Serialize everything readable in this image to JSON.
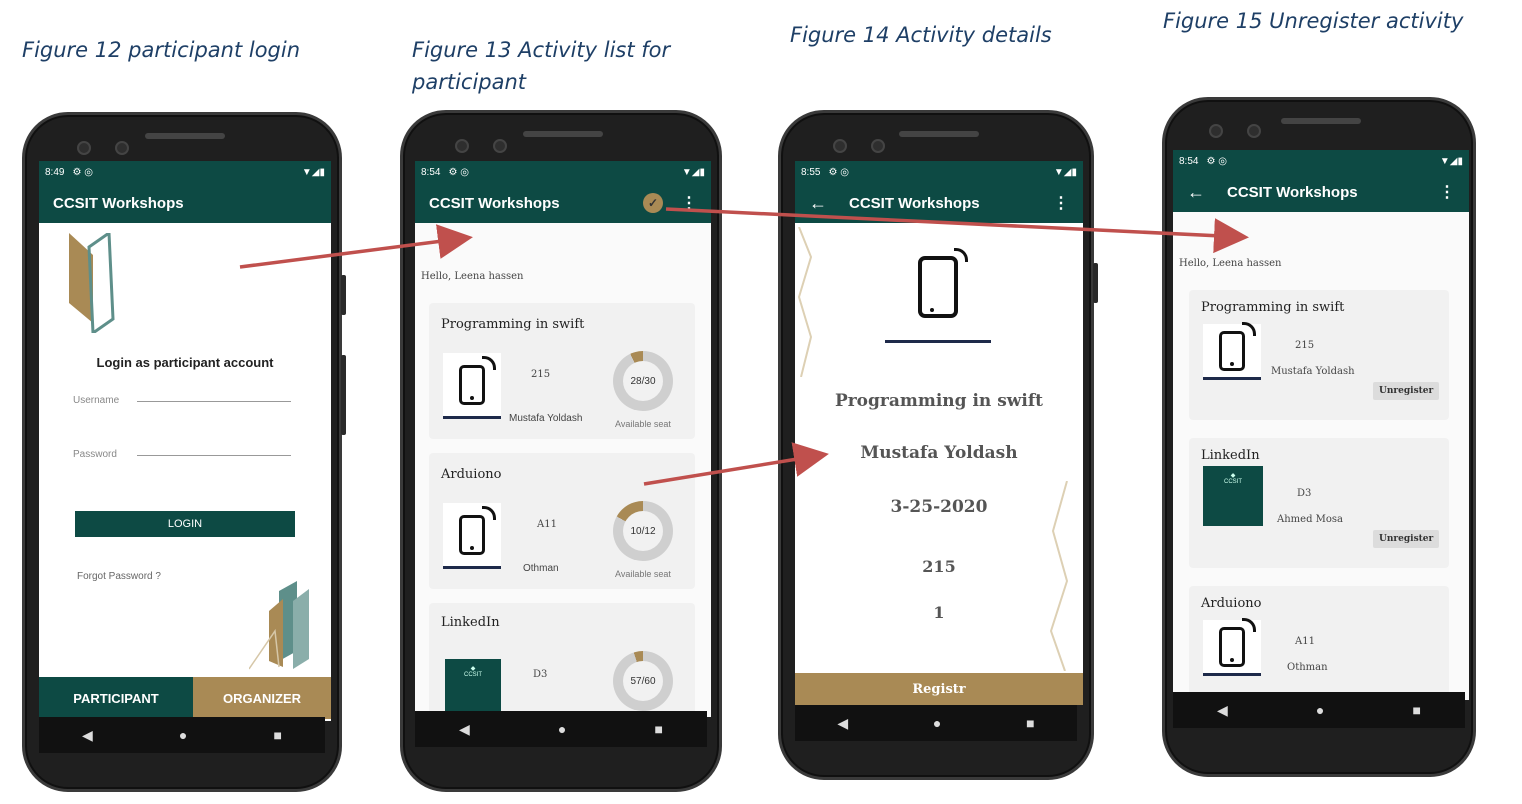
{
  "captions": {
    "fig12": "Figure 12  participant login",
    "fig13a": "Figure 13 Activity list for",
    "fig13b": "participant",
    "fig14": "Figure 14 Activity details",
    "fig15": "Figure 15 Unregister activity"
  },
  "colors": {
    "primary": "#0d4a44",
    "accent": "#a98a55",
    "arrow": "#c0504d"
  },
  "phone1": {
    "time": "8:49",
    "app_title": "CCSIT Workshops",
    "heading": "Login as participant account",
    "username_label": "Username",
    "password_label": "Password",
    "login_button": "LOGIN",
    "forgot_password": "Forgot Password ?",
    "tab_participant": "PARTICIPANT",
    "tab_organizer": "ORGANIZER"
  },
  "phone2": {
    "time": "8:54",
    "app_title": "CCSIT Workshops",
    "greeting": "Hello, Leena hassen",
    "seat_label": "Available seat",
    "activities": [
      {
        "title": "Programming in swift",
        "room": "215",
        "instructor": "Mustafa Yoldash",
        "seats": "28/30",
        "fraction": 0.93
      },
      {
        "title": "Arduiono",
        "room": "A11",
        "instructor": "Othman",
        "seats": "10/12",
        "fraction": 0.83
      },
      {
        "title": "LinkedIn",
        "room": "D3",
        "instructor": "",
        "seats": "57/60",
        "fraction": 0.95
      }
    ]
  },
  "phone3": {
    "time": "8:55",
    "app_title": "CCSIT Workshops",
    "title": "Programming in swift",
    "instructor": "Mustafa Yoldash",
    "date": "3-25-2020",
    "room": "215",
    "count": "1",
    "register_button": "Registr"
  },
  "phone4": {
    "time": "8:54",
    "app_title": "CCSIT Workshops",
    "greeting": "Hello, Leena hassen",
    "unregister_label": "Unregister",
    "activities": [
      {
        "title": "Programming in swift",
        "room": "215",
        "instructor": "Mustafa Yoldash"
      },
      {
        "title": "LinkedIn",
        "room": "D3",
        "instructor": "Ahmed Mosa"
      },
      {
        "title": "Arduiono",
        "room": "A11",
        "instructor": "Othman"
      }
    ]
  },
  "icons": {
    "back": "arrow-left-icon",
    "menu": "more-vert-icon",
    "nav": [
      "nav-back-icon",
      "nav-home-icon",
      "nav-recents-icon"
    ],
    "badge": "checkmark-badge-icon"
  }
}
